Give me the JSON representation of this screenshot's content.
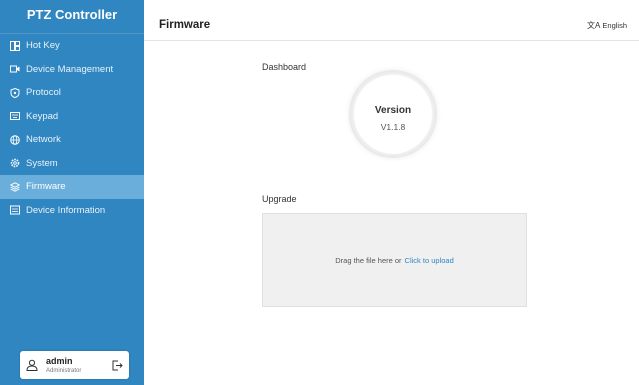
{
  "app": {
    "title": "PTZ Controller"
  },
  "sidebar": {
    "items": [
      {
        "label": "Hot Key",
        "icon": "hotkey-icon"
      },
      {
        "label": "Device Management",
        "icon": "camera-icon"
      },
      {
        "label": "Protocol",
        "icon": "shield-icon"
      },
      {
        "label": "Keypad",
        "icon": "keyboard-icon"
      },
      {
        "label": "Network",
        "icon": "globe-icon"
      },
      {
        "label": "System",
        "icon": "gear-icon"
      },
      {
        "label": "Firmware",
        "icon": "layers-icon",
        "active": true
      },
      {
        "label": "Device Information",
        "icon": "info-card-icon"
      }
    ]
  },
  "user": {
    "name": "admin",
    "role": "Administrator"
  },
  "header": {
    "title": "Firmware",
    "language": "English"
  },
  "dashboard": {
    "label": "Dashboard",
    "version_title": "Version",
    "version_value": "V1.1.8"
  },
  "upgrade": {
    "label": "Upgrade",
    "drag_text": "Drag the file here or",
    "link_text": "Click to upload"
  },
  "colors": {
    "sidebar": "#2f86c1",
    "active_item": "#6aaedb",
    "link": "#2f86c1"
  }
}
